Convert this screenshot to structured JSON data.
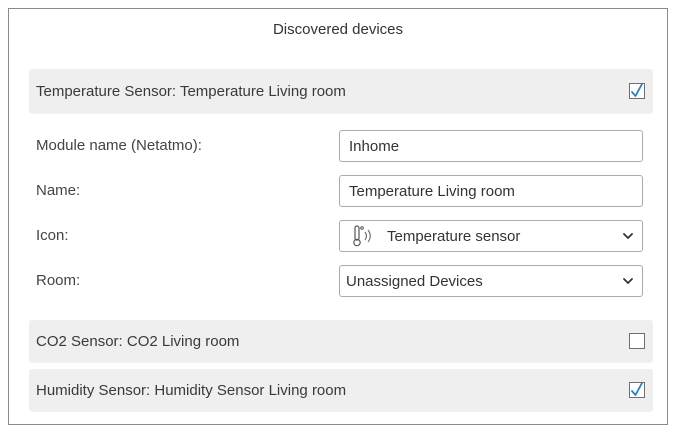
{
  "dialog": {
    "title": "Discovered devices"
  },
  "devices": [
    {
      "label": "Temperature Sensor: Temperature Living room",
      "checked": true
    },
    {
      "label": "CO2 Sensor: CO2 Living room",
      "checked": false
    },
    {
      "label": "Humidity Sensor: Humidity Sensor Living room",
      "checked": true
    }
  ],
  "form": {
    "module_name": {
      "label": "Module name (Netatmo):",
      "value": "Inhome"
    },
    "name": {
      "label": "Name:",
      "value": "Temperature Living room"
    },
    "icon": {
      "label": "Icon:",
      "value": "Temperature sensor",
      "icon": "thermometer-signal-icon"
    },
    "room": {
      "label": "Room:",
      "value": "Unassigned Devices"
    }
  },
  "colors": {
    "checkmark": "#2a7fc1",
    "row_background": "#efefef",
    "border": "#8a8a8a"
  }
}
